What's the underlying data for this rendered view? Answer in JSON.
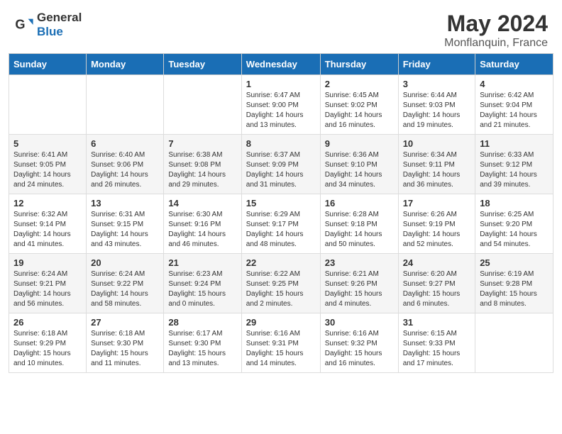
{
  "header": {
    "logo_general": "General",
    "logo_blue": "Blue",
    "title": "May 2024",
    "location": "Monflanquin, France"
  },
  "weekdays": [
    "Sunday",
    "Monday",
    "Tuesday",
    "Wednesday",
    "Thursday",
    "Friday",
    "Saturday"
  ],
  "weeks": [
    [
      {
        "day": "",
        "info": ""
      },
      {
        "day": "",
        "info": ""
      },
      {
        "day": "",
        "info": ""
      },
      {
        "day": "1",
        "info": "Sunrise: 6:47 AM\nSunset: 9:00 PM\nDaylight: 14 hours\nand 13 minutes."
      },
      {
        "day": "2",
        "info": "Sunrise: 6:45 AM\nSunset: 9:02 PM\nDaylight: 14 hours\nand 16 minutes."
      },
      {
        "day": "3",
        "info": "Sunrise: 6:44 AM\nSunset: 9:03 PM\nDaylight: 14 hours\nand 19 minutes."
      },
      {
        "day": "4",
        "info": "Sunrise: 6:42 AM\nSunset: 9:04 PM\nDaylight: 14 hours\nand 21 minutes."
      }
    ],
    [
      {
        "day": "5",
        "info": "Sunrise: 6:41 AM\nSunset: 9:05 PM\nDaylight: 14 hours\nand 24 minutes."
      },
      {
        "day": "6",
        "info": "Sunrise: 6:40 AM\nSunset: 9:06 PM\nDaylight: 14 hours\nand 26 minutes."
      },
      {
        "day": "7",
        "info": "Sunrise: 6:38 AM\nSunset: 9:08 PM\nDaylight: 14 hours\nand 29 minutes."
      },
      {
        "day": "8",
        "info": "Sunrise: 6:37 AM\nSunset: 9:09 PM\nDaylight: 14 hours\nand 31 minutes."
      },
      {
        "day": "9",
        "info": "Sunrise: 6:36 AM\nSunset: 9:10 PM\nDaylight: 14 hours\nand 34 minutes."
      },
      {
        "day": "10",
        "info": "Sunrise: 6:34 AM\nSunset: 9:11 PM\nDaylight: 14 hours\nand 36 minutes."
      },
      {
        "day": "11",
        "info": "Sunrise: 6:33 AM\nSunset: 9:12 PM\nDaylight: 14 hours\nand 39 minutes."
      }
    ],
    [
      {
        "day": "12",
        "info": "Sunrise: 6:32 AM\nSunset: 9:14 PM\nDaylight: 14 hours\nand 41 minutes."
      },
      {
        "day": "13",
        "info": "Sunrise: 6:31 AM\nSunset: 9:15 PM\nDaylight: 14 hours\nand 43 minutes."
      },
      {
        "day": "14",
        "info": "Sunrise: 6:30 AM\nSunset: 9:16 PM\nDaylight: 14 hours\nand 46 minutes."
      },
      {
        "day": "15",
        "info": "Sunrise: 6:29 AM\nSunset: 9:17 PM\nDaylight: 14 hours\nand 48 minutes."
      },
      {
        "day": "16",
        "info": "Sunrise: 6:28 AM\nSunset: 9:18 PM\nDaylight: 14 hours\nand 50 minutes."
      },
      {
        "day": "17",
        "info": "Sunrise: 6:26 AM\nSunset: 9:19 PM\nDaylight: 14 hours\nand 52 minutes."
      },
      {
        "day": "18",
        "info": "Sunrise: 6:25 AM\nSunset: 9:20 PM\nDaylight: 14 hours\nand 54 minutes."
      }
    ],
    [
      {
        "day": "19",
        "info": "Sunrise: 6:24 AM\nSunset: 9:21 PM\nDaylight: 14 hours\nand 56 minutes."
      },
      {
        "day": "20",
        "info": "Sunrise: 6:24 AM\nSunset: 9:22 PM\nDaylight: 14 hours\nand 58 minutes."
      },
      {
        "day": "21",
        "info": "Sunrise: 6:23 AM\nSunset: 9:24 PM\nDaylight: 15 hours\nand 0 minutes."
      },
      {
        "day": "22",
        "info": "Sunrise: 6:22 AM\nSunset: 9:25 PM\nDaylight: 15 hours\nand 2 minutes."
      },
      {
        "day": "23",
        "info": "Sunrise: 6:21 AM\nSunset: 9:26 PM\nDaylight: 15 hours\nand 4 minutes."
      },
      {
        "day": "24",
        "info": "Sunrise: 6:20 AM\nSunset: 9:27 PM\nDaylight: 15 hours\nand 6 minutes."
      },
      {
        "day": "25",
        "info": "Sunrise: 6:19 AM\nSunset: 9:28 PM\nDaylight: 15 hours\nand 8 minutes."
      }
    ],
    [
      {
        "day": "26",
        "info": "Sunrise: 6:18 AM\nSunset: 9:29 PM\nDaylight: 15 hours\nand 10 minutes."
      },
      {
        "day": "27",
        "info": "Sunrise: 6:18 AM\nSunset: 9:30 PM\nDaylight: 15 hours\nand 11 minutes."
      },
      {
        "day": "28",
        "info": "Sunrise: 6:17 AM\nSunset: 9:30 PM\nDaylight: 15 hours\nand 13 minutes."
      },
      {
        "day": "29",
        "info": "Sunrise: 6:16 AM\nSunset: 9:31 PM\nDaylight: 15 hours\nand 14 minutes."
      },
      {
        "day": "30",
        "info": "Sunrise: 6:16 AM\nSunset: 9:32 PM\nDaylight: 15 hours\nand 16 minutes."
      },
      {
        "day": "31",
        "info": "Sunrise: 6:15 AM\nSunset: 9:33 PM\nDaylight: 15 hours\nand 17 minutes."
      },
      {
        "day": "",
        "info": ""
      }
    ]
  ]
}
